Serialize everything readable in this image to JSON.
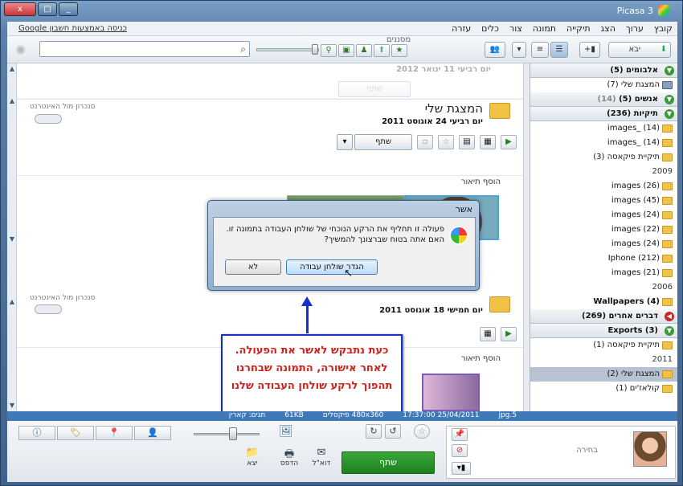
{
  "window": {
    "title": "Picasa 3",
    "close_glyph": "x"
  },
  "menu": {
    "items": [
      "קובץ",
      "ערוך",
      "הצג",
      "תיקייה",
      "תמונה",
      "צור",
      "כלים",
      "עזרה"
    ],
    "sign_in": "כניסה באמצעות חשבון Google"
  },
  "toolbar": {
    "import_label": "יבא",
    "filters_label": "מסננים",
    "search_placeholder": ""
  },
  "sidebar": {
    "rows": [
      {
        "type": "head",
        "label": "אלבומים (5)",
        "toggle": "▼",
        "color": "green"
      },
      {
        "type": "item",
        "label": "המצגת שלי (7)"
      },
      {
        "type": "head",
        "label": "אנשים (5)",
        "count": "(14)",
        "toggle": "▼",
        "color": "green"
      },
      {
        "type": "head",
        "label": "תיקיות (236)",
        "toggle": "▼",
        "color": "green"
      },
      {
        "type": "folder",
        "label": "images_ (14)"
      },
      {
        "type": "folder",
        "label": "images_ (14)"
      },
      {
        "type": "folder",
        "label": "תיקיית פיקאסה (3)"
      },
      {
        "type": "year",
        "label": "2009"
      },
      {
        "type": "folder",
        "label": "images (26)"
      },
      {
        "type": "folder",
        "label": "images (45)"
      },
      {
        "type": "folder",
        "label": "images (24)"
      },
      {
        "type": "folder",
        "label": "images (22)"
      },
      {
        "type": "folder",
        "label": "images (24)"
      },
      {
        "type": "folder",
        "label": "Iphone (212)"
      },
      {
        "type": "folder",
        "label": "images (21)"
      },
      {
        "type": "year",
        "label": "2006"
      },
      {
        "type": "folder",
        "label": "Wallpapers (4)",
        "bold": true
      },
      {
        "type": "head",
        "label": "דברים אחרים (269)",
        "toggle": "◀",
        "color": "red"
      },
      {
        "type": "head",
        "label": "Exports (3)",
        "toggle": "▼",
        "color": "green"
      },
      {
        "type": "folder",
        "label": "תיקיית פיקאסה (1)"
      },
      {
        "type": "year",
        "label": "2011"
      },
      {
        "type": "folder",
        "label": "המצגת שלי (2)",
        "selected": true
      },
      {
        "type": "folder",
        "label": "קולאז'ים (1)"
      }
    ]
  },
  "library": {
    "prev_album_date": "יום רביעי 11 ינואר 2012",
    "album1": {
      "title": "המצגת שלי",
      "date": "יום רביעי 24 אוגוסט 2011",
      "share": "שתף",
      "internet": "סנכרון מול האינטרנט",
      "desc": "הוסף תיאור"
    },
    "album2": {
      "date": "יום חמישי 18 אוגוסט 2011",
      "internet": "סנכרון מול האינטרנט",
      "desc": "הוסף תיאור"
    }
  },
  "dialog": {
    "title": "אשר",
    "message": "פעולה זו תחליף את הרקע הנוכחי של שולחן העבודה בתמונה זו. האם אתה בטוח שברצונך להמשיך?",
    "yes": "הגדר שולחן עבודה",
    "no": "לא"
  },
  "callout": {
    "text": "כעת נתבקש לאשר את הפעולה. לאחר אישורה, התמונה שבחרנו תהפוך לרקע שולחן העבודה שלנו"
  },
  "status": {
    "filename": "5.jpg",
    "datetime": "17:37:00 25/04/2011",
    "dimensions": "480x360 פיקסלים",
    "size": "61KB",
    "tags": "תגים: קארין"
  },
  "bottom": {
    "hold_label": "בחירה",
    "share": "שתף",
    "email": "דוא\"ל",
    "print": "הדפס",
    "export": "יצא"
  }
}
